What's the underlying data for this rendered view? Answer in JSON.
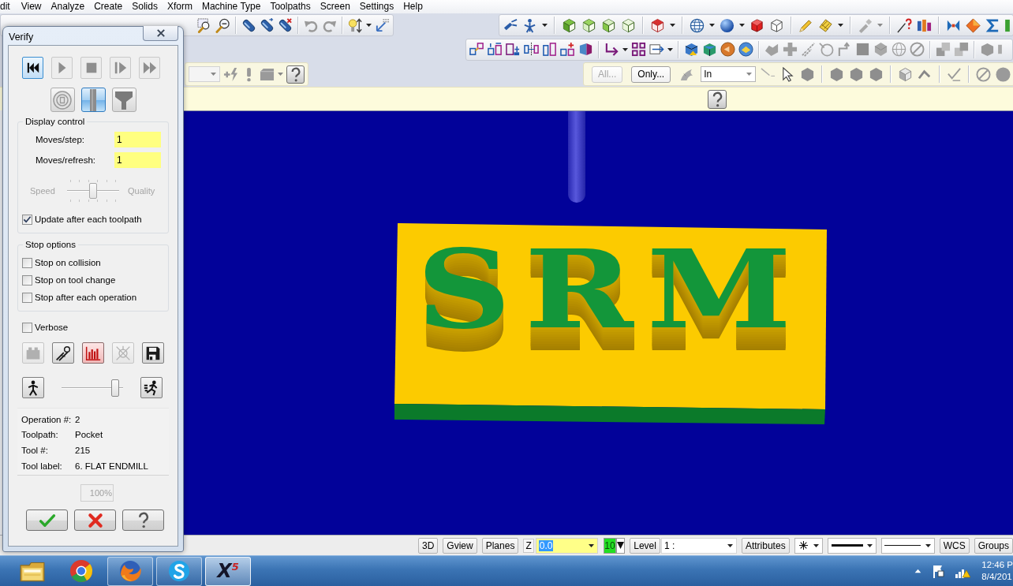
{
  "menu_bar": [
    "dit",
    "View",
    "Analyze",
    "Create",
    "Solids",
    "Xform",
    "Machine Type",
    "Toolpaths",
    "Screen",
    "Settings",
    "Help"
  ],
  "selection_bar": {
    "buttons": [
      {
        "label": "All...",
        "disabled": true
      },
      {
        "label": "Only...",
        "disabled": false
      }
    ],
    "mask_mode": "In"
  },
  "viewport": {
    "part_text": "SRM"
  },
  "verify_dialog": {
    "title": "Verify",
    "playback_buttons": [
      {
        "pressed": true
      },
      {
        "pressed": false
      },
      {
        "pressed": false
      },
      {
        "pressed": false
      },
      {
        "pressed": false
      }
    ],
    "display_buttons": [
      {
        "pressed": false
      },
      {
        "pressed": true
      },
      {
        "pressed": false
      }
    ],
    "display_control": {
      "title": "Display control",
      "fields": [
        {
          "label": "Moves/step:",
          "value": "1"
        },
        {
          "label": "Moves/refresh:",
          "value": "1"
        }
      ],
      "speed_slider": {
        "left_label": "Speed",
        "right_label": "Quality",
        "level": 0.5,
        "disabled": true
      },
      "update_after_each_toolpath": {
        "label": "Update after each toolpath",
        "checked": true
      }
    },
    "stop_options": {
      "title": "Stop options",
      "options": [
        {
          "label": "Stop on collision",
          "checked": false
        },
        {
          "label": "Stop on tool change",
          "checked": false
        },
        {
          "label": "Stop after each operation",
          "checked": false
        }
      ]
    },
    "verbose": {
      "label": "Verbose",
      "checked": false
    },
    "tool_buttons": [
      {
        "pressed": false,
        "disabled": true
      },
      {
        "pressed": false,
        "disabled": false
      },
      {
        "pressed": true,
        "disabled": false
      },
      {
        "pressed": false,
        "disabled": true
      },
      {
        "pressed": false,
        "disabled": false
      }
    ],
    "simulation_speed": {
      "level": 0.93
    },
    "info": [
      {
        "label": "Operation #:",
        "value": "2"
      },
      {
        "label": "Toolpath:",
        "value": "Pocket"
      },
      {
        "label": "Tool #:",
        "value": "215"
      },
      {
        "label": "Tool label:",
        "value": "6. FLAT ENDMILL"
      }
    ],
    "progress": "100%"
  },
  "status_bar": {
    "view_buttons": [
      "3D",
      "Gview",
      "Planes"
    ],
    "z": {
      "label": "Z",
      "value": "0.0",
      "value_selected": true
    },
    "color": {
      "value": "10"
    },
    "level": {
      "label": "Level",
      "value": "1 :"
    },
    "attributes_button": "Attributes",
    "wcs_button": "WCS",
    "groups_button": "Groups"
  },
  "taskbar": {
    "apps": [
      {
        "running": false,
        "selected": false
      },
      {
        "running": false,
        "selected": false
      },
      {
        "running": true,
        "selected": false
      },
      {
        "running": true,
        "selected": false
      },
      {
        "running": true,
        "selected": true,
        "logo": "X$^{5}$"
      }
    ],
    "clock": {
      "time": "12:46 P",
      "date": "8/4/201"
    }
  }
}
